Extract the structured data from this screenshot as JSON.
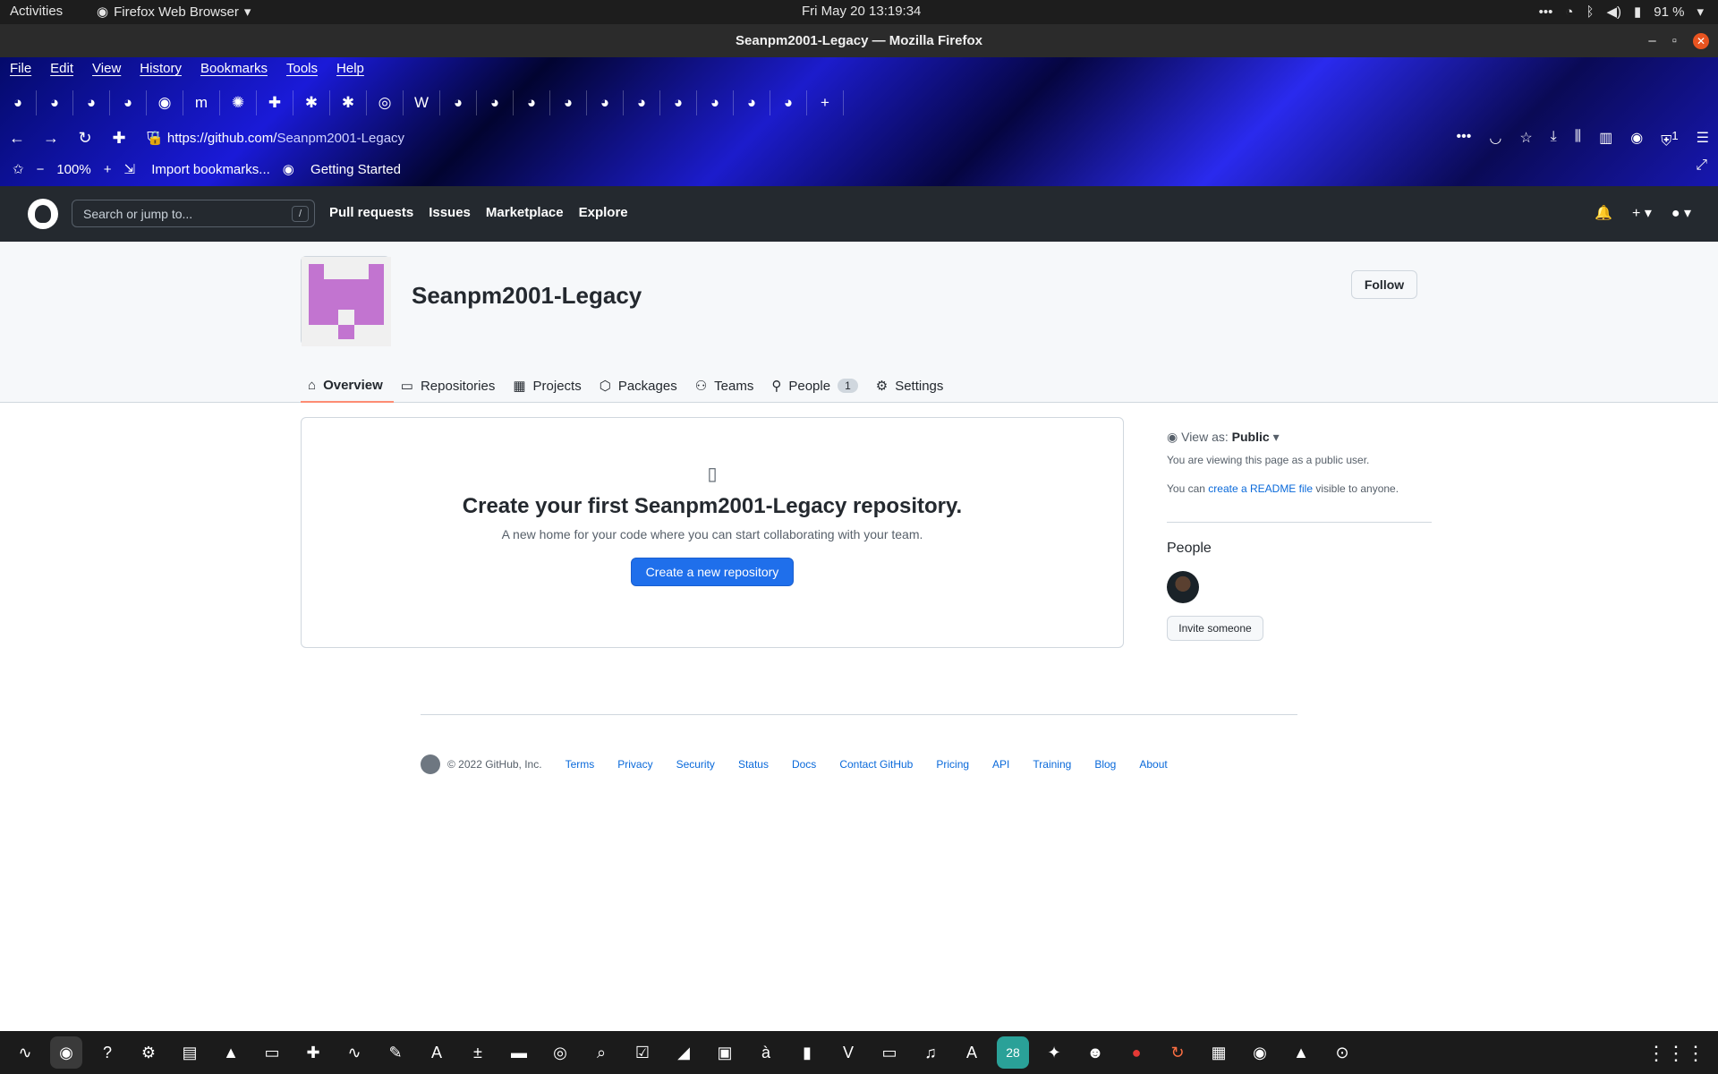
{
  "system": {
    "activities": "Activities",
    "app_name": "Firefox Web Browser",
    "clock": "Fri May 20  13:19:34",
    "battery": "91 %"
  },
  "window": {
    "title": "Seanpm2001-Legacy — Mozilla Firefox"
  },
  "menu": [
    "File",
    "Edit",
    "View",
    "History",
    "Bookmarks",
    "Tools",
    "Help"
  ],
  "browser": {
    "url_prefix": "https://github.com/",
    "url_path": "Seanpm2001-Legacy",
    "zoom": "100%",
    "bookmarks": [
      "Import bookmarks...",
      "Getting Started"
    ],
    "extension_badge": "1"
  },
  "github": {
    "search_placeholder": "Search or jump to...",
    "search_shortcut": "/",
    "nav": [
      "Pull requests",
      "Issues",
      "Marketplace",
      "Explore"
    ]
  },
  "org": {
    "name": "Seanpm2001-Legacy",
    "follow_label": "Follow",
    "tabs": [
      {
        "label": "Overview",
        "icon": "home-icon"
      },
      {
        "label": "Repositories",
        "icon": "repo-icon"
      },
      {
        "label": "Projects",
        "icon": "project-icon"
      },
      {
        "label": "Packages",
        "icon": "package-icon"
      },
      {
        "label": "Teams",
        "icon": "people-icon"
      },
      {
        "label": "People",
        "icon": "person-icon",
        "count": "1"
      },
      {
        "label": "Settings",
        "icon": "gear-icon"
      }
    ]
  },
  "main": {
    "heading": "Create your first Seanpm2001-Legacy repository.",
    "subtext": "A new home for your code where you can start collaborating with your team.",
    "create_button": "Create a new repository"
  },
  "sidebar": {
    "view_as_label": "View as:",
    "view_as_value": "Public",
    "viewing_text": "You are viewing this page as a public user.",
    "readme_prefix": "You can",
    "readme_link": "create a README file",
    "readme_suffix": "visible to anyone.",
    "people_heading": "People",
    "invite_button": "Invite someone"
  },
  "footer": {
    "copyright": "© 2022 GitHub, Inc.",
    "links": [
      "Terms",
      "Privacy",
      "Security",
      "Status",
      "Docs",
      "Contact GitHub",
      "Pricing",
      "API",
      "Training",
      "Blog",
      "About"
    ]
  },
  "colors": {
    "accent": "#1f6feb",
    "tab_underline": "#fd8c73",
    "header": "#24292f"
  }
}
